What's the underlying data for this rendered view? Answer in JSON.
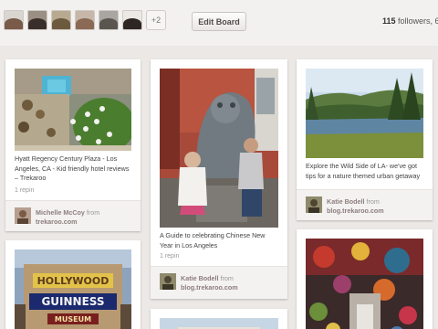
{
  "header": {
    "more_collaborators": "+2",
    "edit_board_label": "Edit Board",
    "followers_count": "115",
    "followers_label": " followers, 6"
  },
  "pins": [
    {
      "description": "Hyatt Regency Century Plaza - Los Angeles, CA - Kid friendly hotel reviews – Trekaroo",
      "repins": "1 repin",
      "pinner": "Michelle McCoy",
      "from": "from",
      "source": "trekaroo.com"
    },
    {
      "description": "A Guide to celebrating Chinese New Year in Los Angeles",
      "repins": "1 repin",
      "pinner": "Katie Bodell",
      "from": "from",
      "source": "blog.trekaroo.com"
    },
    {
      "description": "Explore the Wild Side of LA- we've got tips for a nature themed urban getaway",
      "pinner": "Katie Bodell",
      "from": "from",
      "source": "blog.trekaroo.com"
    }
  ],
  "signs": {
    "hollywood": "HOLLYWOOD",
    "guinness": "GUINNESS",
    "museum": "MUSEUM"
  },
  "colors": {
    "background": "#ebe8e5",
    "pinner_text": "#8c7e7e",
    "card": "#ffffff"
  }
}
